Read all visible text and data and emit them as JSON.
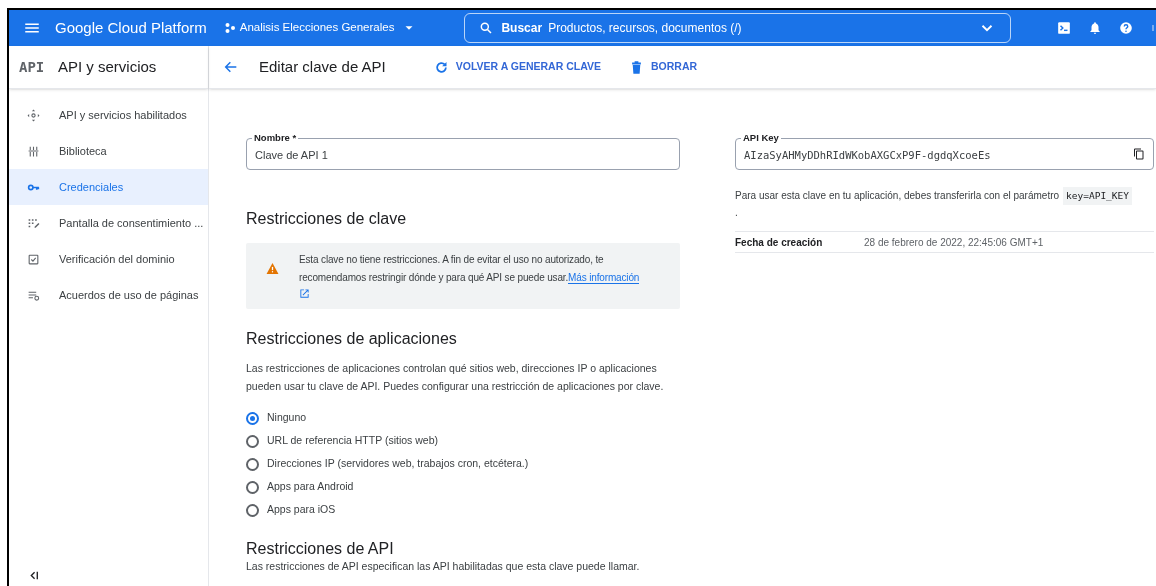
{
  "topbar": {
    "product": "Google Cloud Platform",
    "project": "Analisis Elecciones Generales",
    "search": {
      "label": "Buscar",
      "placeholder": "Productos, recursos, documentos (/)"
    }
  },
  "sidebar": {
    "logo": "API",
    "title": "API y servicios",
    "items": [
      {
        "label": "API y servicios habilitados",
        "selected": false
      },
      {
        "label": "Biblioteca",
        "selected": false
      },
      {
        "label": "Credenciales",
        "selected": true
      },
      {
        "label": "Pantalla de consentimiento ...",
        "selected": false
      },
      {
        "label": "Verificación del dominio",
        "selected": false
      },
      {
        "label": "Acuerdos de uso de páginas",
        "selected": false
      }
    ]
  },
  "header": {
    "title": "Editar clave de API",
    "actions": [
      "VOLVER A GENERAR CLAVE",
      "BORRAR"
    ]
  },
  "name_field": {
    "label": "Nombre *",
    "value": "Clave de API 1"
  },
  "key_restrictions": {
    "heading": "Restricciones de clave",
    "warning": "Esta clave no tiene restricciones. A fin de evitar el uso no autorizado, te recomendamos restringir dónde y para qué API se puede usar.",
    "link": "Más información"
  },
  "app_restrictions": {
    "heading": "Restricciones de aplicaciones",
    "description": "Las restricciones de aplicaciones controlan qué sitios web, direcciones IP o aplicaciones pueden usar tu clave de API. Puedes configurar una restricción de aplicaciones por clave.",
    "options": [
      {
        "label": "Ninguno",
        "selected": true
      },
      {
        "label": "URL de referencia HTTP (sitios web)",
        "selected": false
      },
      {
        "label": "Direcciones IP (servidores web, trabajos cron, etcétera.)",
        "selected": false
      },
      {
        "label": "Apps para Android",
        "selected": false
      },
      {
        "label": "Apps para iOS",
        "selected": false
      }
    ]
  },
  "api_restrictions": {
    "heading": "Restricciones de API",
    "description": "Las restricciones de API especifican las API habilitadas que esta clave puede llamar."
  },
  "api_key": {
    "label": "API Key",
    "value": "AIzaSyAHMyDDhRIdWKobAXGCxP9F-dgdqXcoeEs",
    "usage": "Para usar esta clave en tu aplicación, debes transferirla con el parámetro",
    "param": "key=API_KEY",
    "period": "."
  },
  "creation": {
    "label": "Fecha de creación",
    "value": "28 de febrero de 2022, 22:45:06 GMT+1"
  }
}
